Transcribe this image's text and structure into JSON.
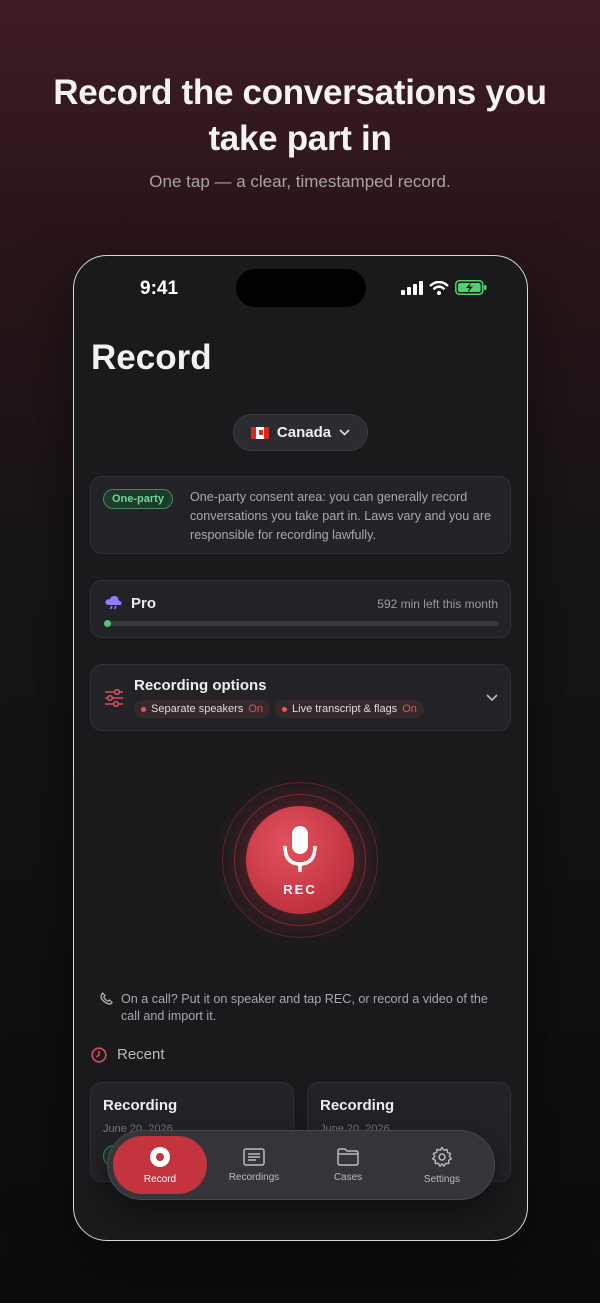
{
  "hero": {
    "title_line1": "Record the conversations you",
    "title_line2": "take part in",
    "subtitle": "One tap — a clear, timestamped record."
  },
  "status_bar": {
    "time": "9:41"
  },
  "page": {
    "title": "Record"
  },
  "country_selector": {
    "label": "Canada"
  },
  "consent": {
    "badge": "One-party",
    "text": "One-party consent area: you can generally record conversations you take part in. Laws vary and you are responsible for recording lawfully."
  },
  "plan": {
    "name": "Pro",
    "remaining": "592 min left this month",
    "usage_fraction": 0.01
  },
  "options": {
    "title": "Recording options",
    "chips": [
      {
        "label": "Separate speakers",
        "state": "On"
      },
      {
        "label": "Live transcript & flags",
        "state": "On"
      }
    ]
  },
  "record_button": {
    "label": "REC"
  },
  "tip": "On a call? Put it on speaker and tap REC, or record a video of the call and import it.",
  "recent": {
    "heading": "Recent",
    "items": [
      {
        "title": "Recording",
        "date": "June 20, 2026"
      },
      {
        "title": "Recording",
        "date": "June 20, 2026"
      }
    ]
  },
  "tabs": [
    {
      "label": "Record",
      "icon": "record-icon",
      "active": true
    },
    {
      "label": "Recordings",
      "icon": "list-icon",
      "active": false
    },
    {
      "label": "Cases",
      "icon": "folder-icon",
      "active": false
    },
    {
      "label": "Settings",
      "icon": "gear-icon",
      "active": false
    }
  ],
  "colors": {
    "accent": "#c4343f",
    "consent_green": "#6ed69e",
    "pro_icon": "#8f7dff"
  }
}
